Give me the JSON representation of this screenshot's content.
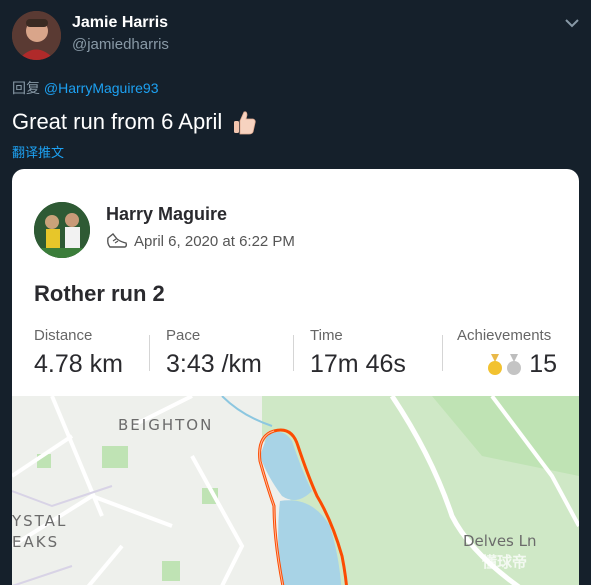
{
  "tweet": {
    "author_name": "Jamie Harris",
    "author_handle": "@jamiedharris",
    "reply_prefix": "回复",
    "reply_mention": "@HarryMaguire93",
    "text": "Great run from 6 April",
    "translate_label": "翻译推文"
  },
  "card": {
    "athlete_name": "Harry Maguire",
    "date": "April 6, 2020 at 6:22 PM",
    "activity_title": "Rother run 2",
    "stats": [
      {
        "label": "Distance",
        "value": "4.78 km"
      },
      {
        "label": "Pace",
        "value": "3:43 /km"
      },
      {
        "label": "Time",
        "value": "17m 46s"
      },
      {
        "label": "Achievements",
        "value": "15"
      }
    ],
    "map_labels": {
      "beighton": "BEIGHTON",
      "crystal_line1": "YSTAL",
      "crystal_line2": "EAKS",
      "delves": "Delves Ln"
    }
  },
  "watermark": "懂球帝",
  "colors": {
    "background": "#15202b",
    "link": "#1da1f2",
    "muted": "#8899a6",
    "route": "#fc4c02",
    "water": "#a8d3e6",
    "park": "#bfe3b4"
  },
  "icons": [
    "chevron-down-icon",
    "thumbs-up-emoji",
    "shoe-icon",
    "gold-medal-icon",
    "silver-medal-icon"
  ]
}
